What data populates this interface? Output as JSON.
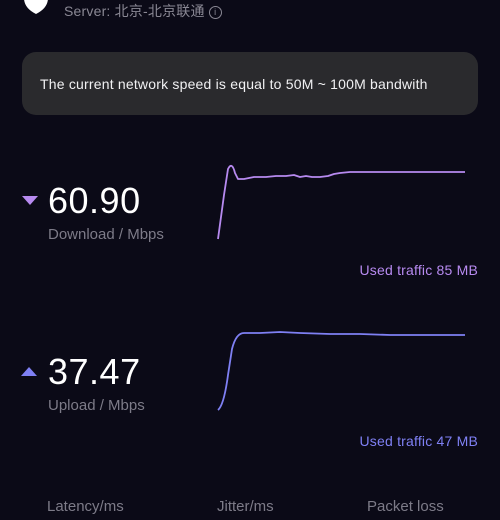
{
  "server": {
    "label": "Server: 北京-北京联通",
    "info_glyph": "i"
  },
  "banner": {
    "message": "The current network speed is equal to 50M ~ 100M bandwith"
  },
  "download": {
    "value": "60.90",
    "label": "Download / Mbps",
    "traffic": "Used traffic 85 MB",
    "color": "#b78af0"
  },
  "upload": {
    "value": "37.47",
    "label": "Upload / Mbps",
    "traffic": "Used traffic 47 MB",
    "color": "#7f80f4"
  },
  "footer": {
    "latency_label": "Latency/ms",
    "jitter_label": "Jitter/ms",
    "packet_loss_label": "Packet loss"
  },
  "colors": {
    "background": "#0b0a17",
    "banner": "#2a2a2d",
    "muted_text": "#7d7b88"
  }
}
